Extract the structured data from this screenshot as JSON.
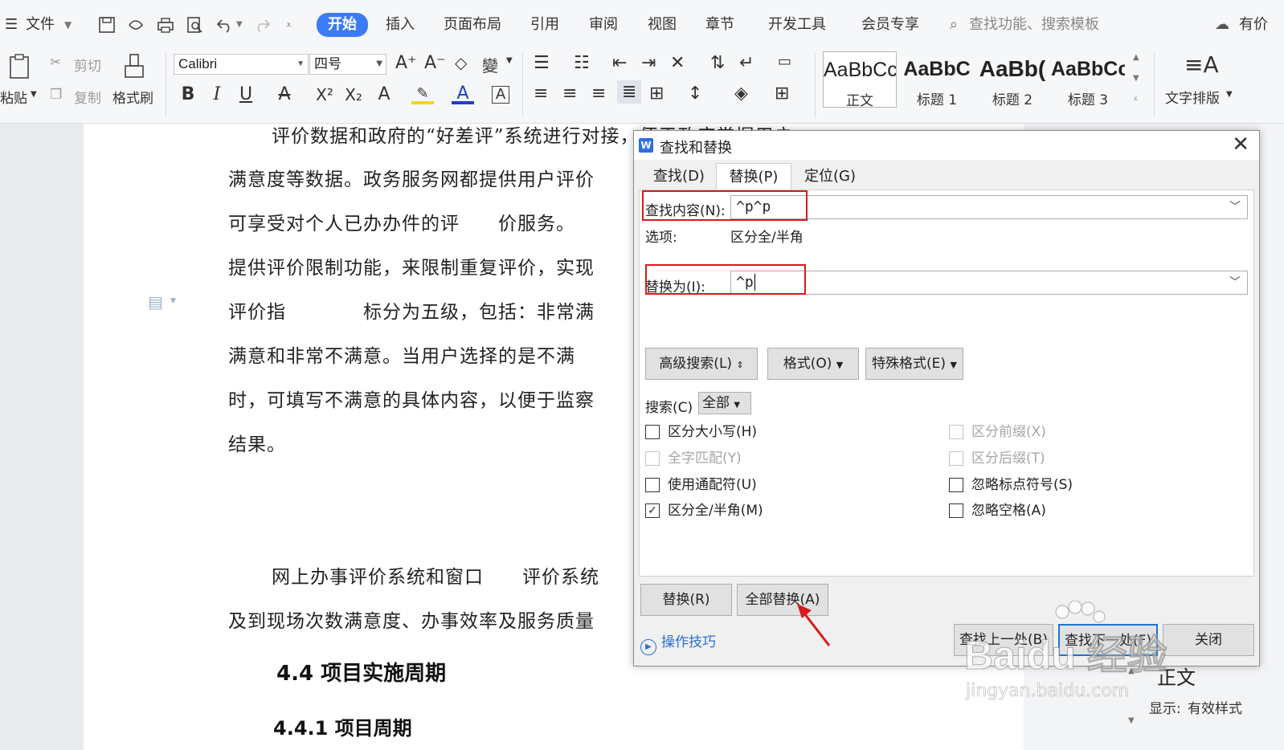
{
  "menubar": {
    "file": "文件",
    "tabs": [
      "开始",
      "插入",
      "页面布局",
      "引用",
      "审阅",
      "视图",
      "章节",
      "开发工具",
      "会员专享"
    ],
    "search_placeholder": "查找功能、搜索模板",
    "right_text": "有价"
  },
  "ribbon": {
    "paste": "粘贴",
    "cut": "剪切",
    "copy": "复制",
    "format_painter": "格式刷",
    "font_name": "Calibri",
    "font_size": "四号",
    "styles": [
      {
        "preview": "AaBbCcI",
        "label": "正文"
      },
      {
        "preview": "AaBbC",
        "label": "标题 1"
      },
      {
        "preview": "AaBb(",
        "label": "标题 2"
      },
      {
        "preview": "AaBbCc",
        "label": "标题 3"
      }
    ],
    "text_layout": "文字排版"
  },
  "document": {
    "lines": [
      "评价数据和政府的“好差评”系统进行对接，便于政府掌握用户",
      "满意度等数据。政务服务网都提供用户评价",
      "可享受对个人已办办件的评　　价服务。",
      "提供评价限制功能，来限制重复评价，实现",
      "评价指　　　　标分为五级，包括：非常满",
      "满意和非常不满意。当用户选择的是不满",
      "时，可填写不满意的具体内容，以便于监察",
      "结果。",
      "网上办事评价系统和窗口　　评价系统",
      "及到现场次数满意度、办事效率及服务质量"
    ],
    "heading1": "4.4 项目实施周期",
    "heading2": "4.4.1 项目周期"
  },
  "right_panel": {
    "style_name": "正文",
    "show_label": "显示:",
    "show_value": "有效样式"
  },
  "dialog": {
    "title": "查找和替换",
    "tabs": [
      "查找(D)",
      "替换(P)",
      "定位(G)"
    ],
    "find_label": "查找内容(N):",
    "find_value": "^p^p",
    "options_label": "选项:",
    "options_value": "区分全/半角",
    "replace_label": "替换为(I):",
    "replace_value": "^p",
    "btn_advanced": "高级搜索(L)",
    "btn_format": "格式(O)",
    "btn_special": "特殊格式(E)",
    "search_label": "搜索(C)",
    "search_value": "全部",
    "checks_left": [
      {
        "label": "区分大小写(H)",
        "checked": false,
        "disabled": false
      },
      {
        "label": "全字匹配(Y)",
        "checked": false,
        "disabled": true
      },
      {
        "label": "使用通配符(U)",
        "checked": false,
        "disabled": false
      },
      {
        "label": "区分全/半角(M)",
        "checked": true,
        "disabled": false
      }
    ],
    "checks_right": [
      {
        "label": "区分前缀(X)",
        "checked": false,
        "disabled": true
      },
      {
        "label": "区分后缀(T)",
        "checked": false,
        "disabled": true
      },
      {
        "label": "忽略标点符号(S)",
        "checked": false,
        "disabled": false
      },
      {
        "label": "忽略空格(A)",
        "checked": false,
        "disabled": false
      }
    ],
    "btn_replace": "替换(R)",
    "btn_replace_all": "全部替换(A)",
    "tips": "操作技巧",
    "btn_find_prev": "查找上一处(B)",
    "btn_find_next": "查找下一处(F)",
    "btn_close": "关闭"
  },
  "watermark": {
    "brand": "Baidu 经验",
    "url": "jingyan.baidu.com"
  },
  "colors": {
    "accent": "#3b7bf6",
    "highlight_box": "#d61b1b",
    "arrow": "#d61b1b",
    "link": "#2a6fd6"
  }
}
